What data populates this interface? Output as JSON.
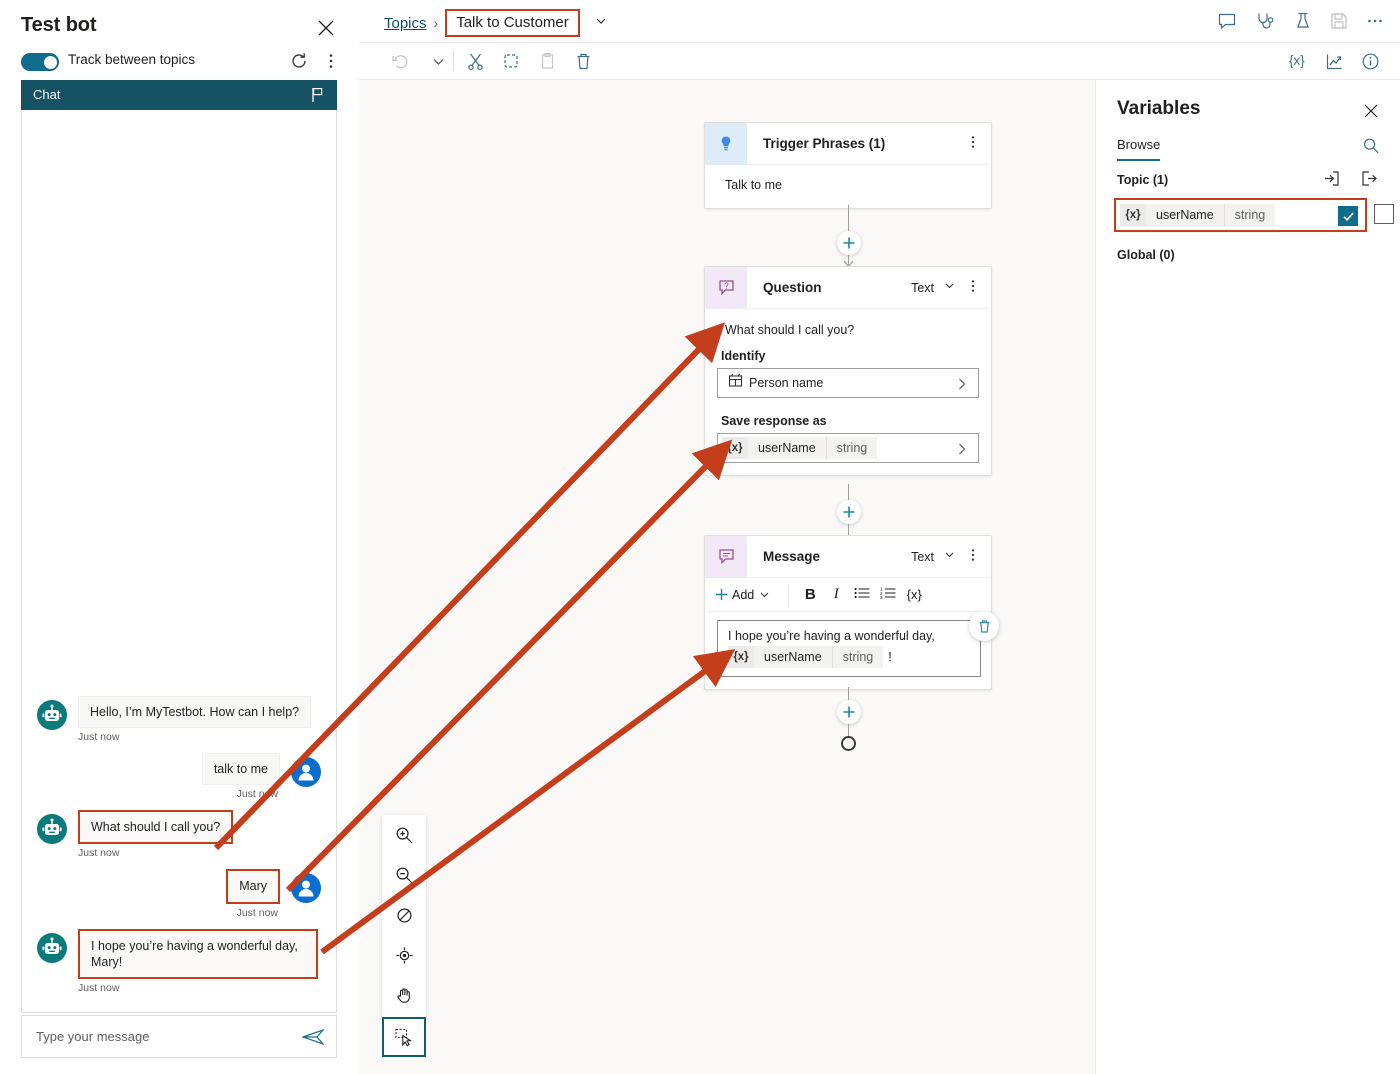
{
  "chat": {
    "title": "Test bot",
    "close_icon": "close-icon",
    "track_toggle_label": "Track between topics",
    "track_toggle_on": true,
    "refresh_icon": "refresh-icon",
    "more_icon": "more-vertical-icon",
    "header_label": "Chat",
    "flag_icon": "flag-icon",
    "messages": [
      {
        "sender": "bot",
        "text": "Hello, I’m MyTestbot. How can I help?",
        "timestamp": "Just now",
        "highlighted": false
      },
      {
        "sender": "user",
        "text": "talk to me",
        "timestamp": "Just now",
        "highlighted": false
      },
      {
        "sender": "bot",
        "text": "What should I call you?",
        "timestamp": "Just now",
        "highlighted": true
      },
      {
        "sender": "user",
        "text": "Mary",
        "timestamp": "Just now",
        "highlighted": true
      },
      {
        "sender": "bot",
        "text": "I hope you’re having a wonderful day, Mary!",
        "timestamp": "Just now",
        "highlighted": true
      }
    ],
    "input_placeholder": "Type your message",
    "input_value": "",
    "send_icon": "send-icon"
  },
  "topbar": {
    "breadcrumb_root": "Topics",
    "breadcrumb_separator": "›",
    "breadcrumb_current": "Talk to Customer",
    "chevron_icon": "chevron-down-icon",
    "icons": [
      {
        "name": "comment-icon"
      },
      {
        "name": "stethoscope-icon"
      },
      {
        "name": "flask-icon"
      },
      {
        "name": "save-icon"
      },
      {
        "name": "more-horizontal-icon"
      }
    ]
  },
  "edit_toolbar": {
    "undo_icon": "undo-icon",
    "caret_icon": "chevron-down-icon",
    "cut_icon": "cut-icon",
    "copy_icon": "copy-icon",
    "paste_icon": "paste-icon",
    "delete_icon": "trash-icon",
    "variables_icon": "variable-icon",
    "analytics_icon": "analytics-icon",
    "info_icon": "info-icon"
  },
  "canvas": {
    "trigger_node": {
      "icon": "lightbulb-icon",
      "title": "Trigger Phrases (1)",
      "kebab_icon": "more-vertical-icon",
      "phrase": "Talk to me"
    },
    "question_node": {
      "icon": "question-bubble-icon",
      "title": "Question",
      "type": "Text",
      "type_chevron": "chevron-down-icon",
      "kebab_icon": "more-vertical-icon",
      "prompt": "What should I call you?",
      "identify_label": "Identify",
      "identify_value": "Person name",
      "identify_icon": "entity-icon",
      "identify_chevron": "chevron-right-icon",
      "save_label": "Save response as",
      "save_var_symbol": "{x}",
      "save_var_name": "userName",
      "save_var_type": "string",
      "save_chevron": "chevron-right-icon"
    },
    "message_node": {
      "icon": "message-bubble-icon",
      "title": "Message",
      "type": "Text",
      "type_chevron": "chevron-down-icon",
      "kebab_icon": "more-vertical-icon",
      "add_label": "Add",
      "add_icon": "plus-icon",
      "add_chevron": "chevron-down-icon",
      "bold_label": "B",
      "italic_label": "I",
      "bullet_list_icon": "bullet-list-icon",
      "numbered_list_icon": "numbered-list-icon",
      "variable_label": "{x}",
      "delete_icon": "trash-icon",
      "body_line1": "I hope you’re having a wonderful day,",
      "body_var_symbol": "{x}",
      "body_var_name": "userName",
      "body_var_type": "string",
      "body_line_suffix": "!"
    },
    "add_node_icon": "plus-circle-icon",
    "end_node_icon": "end-circle-icon",
    "zoom_tools": [
      {
        "name": "zoom-in-icon"
      },
      {
        "name": "zoom-out-icon"
      },
      {
        "name": "zoom-reset-icon"
      },
      {
        "name": "fit-to-view-icon"
      },
      {
        "name": "pan-hand-icon"
      }
    ],
    "select_tool_icon": "select-tool-icon",
    "info_badge": "i"
  },
  "variables": {
    "title": "Variables",
    "close_icon": "close-icon",
    "tab_label": "Browse",
    "search_icon": "search-icon",
    "topic_label": "Topic (1)",
    "input_icon": "variable-input-icon",
    "output_icon": "variable-output-icon",
    "rows": [
      {
        "symbol": "{x}",
        "name": "userName",
        "type": "string",
        "checked": true
      }
    ],
    "global_label": "Global (0)"
  },
  "annotation": {
    "color": "#c43e1c",
    "arrow_count": 3
  }
}
